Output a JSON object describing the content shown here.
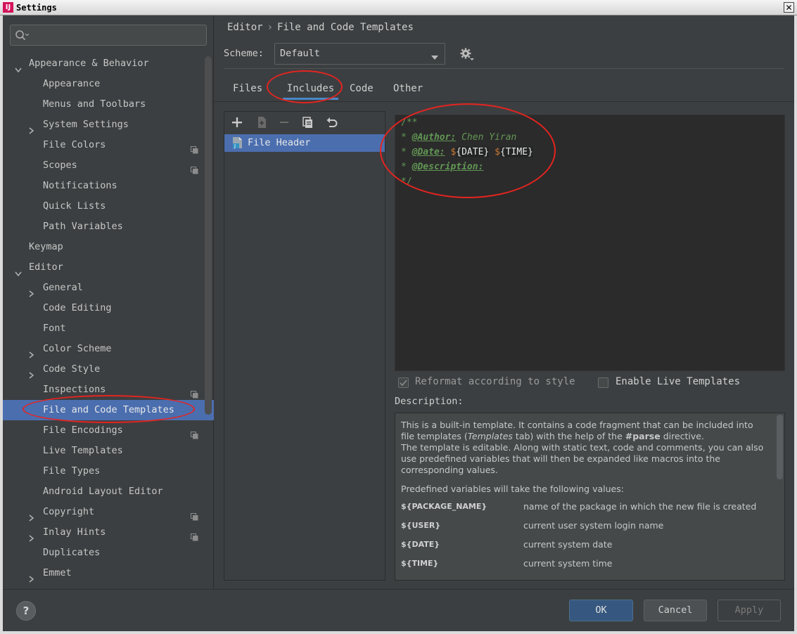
{
  "window": {
    "title": "Settings",
    "app_icon": "intellij-icon",
    "close_glyph": "✕"
  },
  "search": {
    "placeholder": "",
    "icon": "search-icon"
  },
  "sidebar": {
    "items": [
      {
        "label": "Appearance & Behavior",
        "expander": "expanded",
        "bold": true
      },
      {
        "label": "Appearance"
      },
      {
        "label": "Menus and Toolbars"
      },
      {
        "label": "System Settings",
        "expander": "collapsed"
      },
      {
        "label": "File Colors",
        "project_icon": true
      },
      {
        "label": "Scopes",
        "project_icon": true
      },
      {
        "label": "Notifications"
      },
      {
        "label": "Quick Lists"
      },
      {
        "label": "Path Variables"
      },
      {
        "label": "Keymap",
        "bold": true
      },
      {
        "label": "Editor",
        "expander": "expanded",
        "bold": true
      },
      {
        "label": "General",
        "expander": "collapsed"
      },
      {
        "label": "Code Editing"
      },
      {
        "label": "Font"
      },
      {
        "label": "Color Scheme",
        "expander": "collapsed"
      },
      {
        "label": "Code Style",
        "expander": "collapsed"
      },
      {
        "label": "Inspections",
        "project_icon": true
      },
      {
        "label": "File and Code Templates",
        "selected": true
      },
      {
        "label": "File Encodings",
        "project_icon": true
      },
      {
        "label": "Live Templates"
      },
      {
        "label": "File Types"
      },
      {
        "label": "Android Layout Editor"
      },
      {
        "label": "Copyright",
        "expander": "collapsed",
        "project_icon": true
      },
      {
        "label": "Inlay Hints",
        "expander": "collapsed",
        "project_icon": true
      },
      {
        "label": "Duplicates"
      },
      {
        "label": "Emmet",
        "expander": "collapsed"
      }
    ]
  },
  "breadcrumb": {
    "parent": "Editor",
    "separator": "›",
    "current": "File and Code Templates"
  },
  "scheme": {
    "label": "Scheme:",
    "value": "Default",
    "settings_icon": "gear-icon"
  },
  "tabs": [
    "Files",
    "Includes",
    "Code",
    "Other"
  ],
  "active_tab": "Includes",
  "toolbar": [
    "add-icon",
    "copy-template-icon",
    "remove-icon",
    "duplicate-icon",
    "reset-icon"
  ],
  "templates": {
    "items": [
      "File Header"
    ],
    "selected": "File Header"
  },
  "editor": {
    "line1": "/**",
    "line2_prefix": "* ",
    "line2_tag": "@Author:",
    "line2_value": " Chen Yiran",
    "line3_prefix": "* ",
    "line3_tag": "@Date:",
    "line3_space": " ",
    "line3_d1": "$",
    "line3_v1": "{DATE}",
    "line3_d2": "$",
    "line3_v2": "{TIME}",
    "line4_prefix": "* ",
    "line4_tag": "@Description:",
    "line5": "*/"
  },
  "options": {
    "reformat": {
      "label": "Reformat according to style",
      "checked": true,
      "disabled": true
    },
    "live_templates": {
      "label": "Enable Live Templates",
      "checked": false
    }
  },
  "description": {
    "label": "Description:",
    "p1_a": "This is a built-in template. It contains a code fragment that can be included into file templates (",
    "p1_em": "Templates",
    "p1_b": " tab) with the help of the ",
    "p1_strong": "#parse",
    "p1_c": " directive.",
    "p2": "The template is editable. Along with static text, code and comments, you can also use predefined variables that will then be expanded like macros into the corresponding values.",
    "p3": "Predefined variables will take the following values:",
    "variables": [
      {
        "name": "${PACKAGE_NAME}",
        "desc": "name of the package in which the new file is created"
      },
      {
        "name": "${USER}",
        "desc": "current user system login name"
      },
      {
        "name": "${DATE}",
        "desc": "current system date"
      },
      {
        "name": "${TIME}",
        "desc": "current system time"
      }
    ]
  },
  "buttons": {
    "help": "?",
    "ok": "OK",
    "cancel": "Cancel",
    "apply": "Apply"
  },
  "colors": {
    "background": "#3c3f41",
    "selection": "#4b6eaf",
    "editor_bg": "#2b2b2b",
    "doc_comment": "#629755",
    "annotation_red": "#e52420",
    "ok_button": "#365880"
  }
}
